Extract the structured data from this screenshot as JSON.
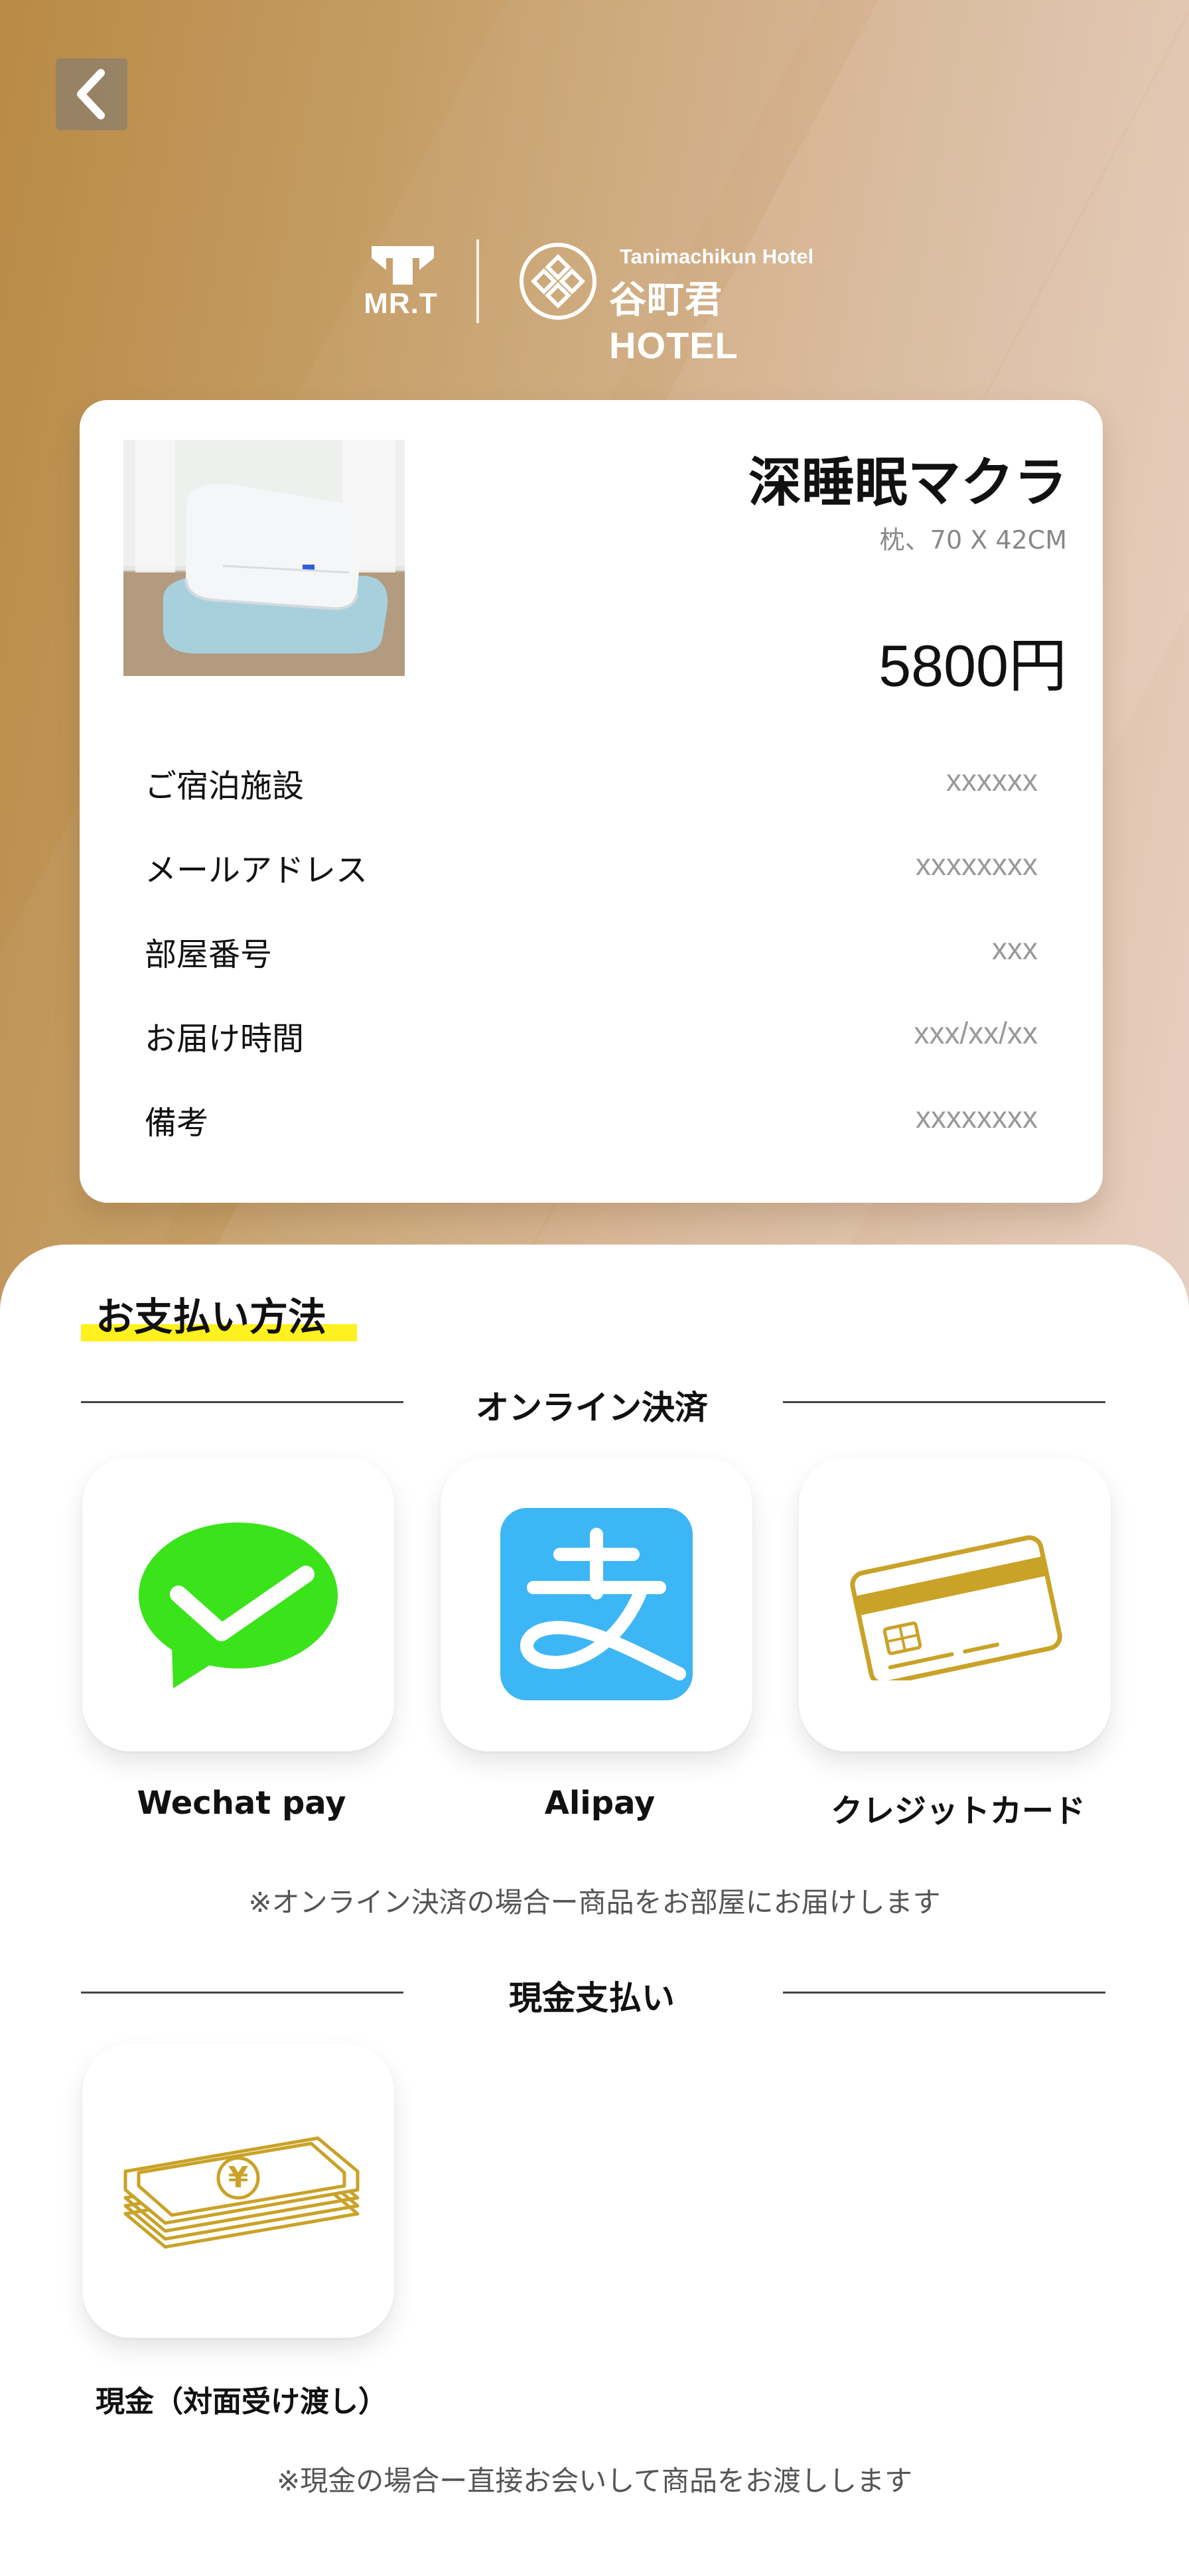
{
  "header": {
    "back_icon": "chevron-left-icon",
    "brand_mrt": "MR.T",
    "hotel_subtitle": "Tanimachikun Hotel",
    "hotel_name": "谷町君HOTEL"
  },
  "product": {
    "name": "深睡眠マクラ",
    "spec": "枕、70 X 42CM",
    "price": "5800円",
    "image": "pillow-photo"
  },
  "details": [
    {
      "label": "ご宿泊施設",
      "value": "xxxxxx"
    },
    {
      "label": "メールアドレス",
      "value": "xxxxxxxx"
    },
    {
      "label": "部屋番号",
      "value": "xxx"
    },
    {
      "label": "お届け時間",
      "value": "xxx/xx/xx"
    },
    {
      "label": "備考",
      "value": "xxxxxxxx"
    }
  ],
  "payment": {
    "section_title": "お支払い方法",
    "online_heading": "オンライン決済",
    "methods": [
      {
        "label": "Wechat pay",
        "icon": "wechat-pay-icon"
      },
      {
        "label": "Alipay",
        "icon": "alipay-icon"
      },
      {
        "label": "クレジットカード",
        "icon": "credit-card-icon"
      }
    ],
    "online_note": "※オンライン決済の場合ー商品をお部屋にお届けします",
    "cash_heading": "現金支払い",
    "cash_method": {
      "label": "現金（対面受け渡し）",
      "icon": "cash-icon"
    },
    "cash_note": "※現金の場合ー直接お会いして商品をお渡しします"
  },
  "colors": {
    "gold": "#c9a227",
    "wechat_green": "#3be31a",
    "alipay_blue": "#3db6f5",
    "highlight": "#fff01f"
  }
}
